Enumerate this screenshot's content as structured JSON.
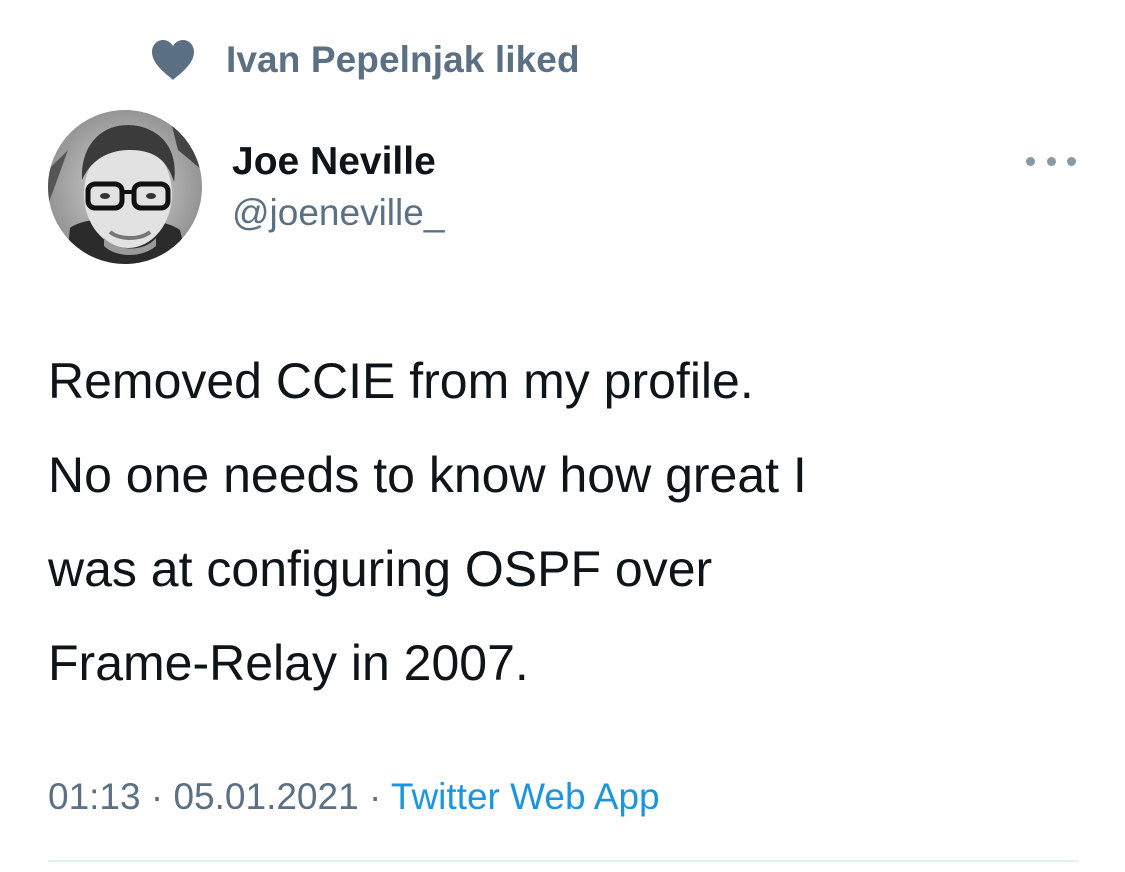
{
  "social_context": {
    "icon": "heart-icon",
    "text": "Ivan Pepelnjak liked"
  },
  "author": {
    "display_name": "Joe Neville",
    "handle": "@joeneville_",
    "avatar": "avatar"
  },
  "more": {
    "icon": "more-dots-icon"
  },
  "tweet": {
    "lines": [
      "Removed CCIE from my profile.",
      "No one needs to know how great I",
      "was at configuring OSPF over",
      "Frame-Relay in 2007."
    ]
  },
  "meta": {
    "time": "01:13",
    "separator": " · ",
    "date": "05.01.2021",
    "source": "Twitter Web App"
  },
  "colors": {
    "secondary_text": "#5b7083",
    "link": "#1b95e0",
    "primary_text": "#0f1419",
    "divider": "#e6ecf0"
  }
}
